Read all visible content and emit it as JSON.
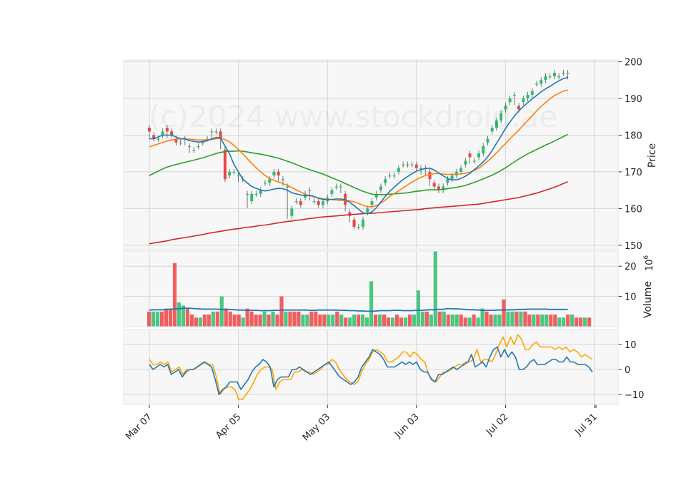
{
  "chart_data": {
    "type": "candlestick",
    "watermark": "(c)2024 www.stockdroid.ae",
    "colors": {
      "up": "#2ebd6f",
      "down": "#ef4444",
      "ma_fast": "#1f77b4",
      "ma_mid": "#ff7f0e",
      "ma_slow": "#2ca02c",
      "ma_long": "#d62728",
      "osc_1": "#1f77b4",
      "osc_2": "#ffa500",
      "volume_ma": "#1f77b4",
      "panel_bg": "#f7f7f7",
      "grid": "#d6d6d6"
    },
    "x_tick_labels": [
      "Mar 07",
      "Apr 05",
      "May 03",
      "Jun 03",
      "Jul 02",
      "Jul 31"
    ],
    "x_tick_positions": [
      0,
      20,
      40,
      60,
      80,
      100
    ],
    "price_panel": {
      "ylabel": "Price",
      "yticks": [
        150,
        160,
        170,
        180,
        190,
        200
      ],
      "ylim": [
        148.8,
        200.5
      ],
      "candles": [
        [
          182,
          181,
          180
        ],
        [
          180,
          179,
          179
        ],
        [
          179,
          179,
          180
        ],
        [
          180,
          181,
          180
        ],
        [
          182,
          181,
          180
        ],
        [
          181,
          180,
          180
        ],
        [
          179,
          178,
          178
        ],
        [
          178,
          178,
          179
        ],
        [
          179,
          179,
          178
        ],
        [
          177,
          177,
          176
        ],
        [
          176,
          176,
          177
        ],
        [
          177,
          177,
          178
        ],
        [
          178,
          178,
          179
        ],
        [
          179,
          179,
          180
        ],
        [
          181,
          181,
          180
        ],
        [
          181,
          181,
          181
        ],
        [
          181,
          179,
          177
        ],
        [
          176,
          168,
          168
        ],
        [
          169,
          170,
          170
        ],
        [
          170,
          170,
          170
        ],
        [
          169,
          169,
          168
        ],
        [
          168,
          168,
          168
        ],
        [
          164,
          164,
          161
        ],
        [
          162,
          164,
          164
        ],
        [
          164,
          164,
          164
        ],
        [
          164,
          165,
          165
        ],
        [
          167,
          167,
          167
        ],
        [
          167,
          168,
          168
        ],
        [
          169,
          170,
          170
        ],
        [
          170,
          169,
          168
        ],
        [
          168,
          168,
          167
        ],
        [
          166,
          166,
          158
        ],
        [
          158,
          160,
          160
        ],
        [
          162,
          162,
          162
        ],
        [
          162,
          161,
          161
        ],
        [
          163,
          164,
          164
        ],
        [
          165,
          165,
          163
        ],
        [
          162,
          162,
          162
        ],
        [
          162,
          161,
          161
        ],
        [
          161,
          162,
          162
        ],
        [
          162,
          163,
          163
        ],
        [
          164,
          165,
          165
        ],
        [
          166,
          166,
          166
        ],
        [
          166,
          166,
          165
        ],
        [
          164,
          161,
          160
        ],
        [
          159,
          158,
          157
        ],
        [
          157,
          155,
          155
        ],
        [
          155,
          155,
          155
        ],
        [
          155,
          157,
          157
        ],
        [
          159,
          160,
          160
        ],
        [
          161,
          162,
          162
        ],
        [
          163,
          164,
          164
        ],
        [
          165,
          166,
          167
        ],
        [
          167,
          168,
          168
        ],
        [
          169,
          169,
          169
        ],
        [
          169,
          169,
          170
        ],
        [
          170,
          171,
          171
        ],
        [
          172,
          172,
          172
        ],
        [
          172,
          172,
          172
        ],
        [
          172,
          172,
          172
        ],
        [
          172,
          171,
          171
        ],
        [
          171,
          171,
          170
        ],
        [
          171,
          171,
          170
        ],
        [
          170,
          168,
          167
        ],
        [
          167,
          166,
          166
        ],
        [
          166,
          165,
          165
        ],
        [
          165,
          166,
          167
        ],
        [
          167,
          168,
          168
        ],
        [
          168,
          169,
          169
        ],
        [
          169,
          170,
          170
        ],
        [
          170,
          171,
          172
        ],
        [
          172,
          173,
          175
        ],
        [
          175,
          174,
          173
        ],
        [
          173,
          173,
          174
        ],
        [
          174,
          175,
          175
        ],
        [
          175,
          177,
          177
        ],
        [
          178,
          179,
          180
        ],
        [
          181,
          182,
          181
        ],
        [
          182,
          184,
          184
        ],
        [
          184,
          186,
          187
        ],
        [
          187,
          188,
          189
        ],
        [
          189,
          190,
          191
        ],
        [
          191,
          191,
          189
        ],
        [
          188,
          187,
          188
        ],
        [
          189,
          190,
          190
        ],
        [
          190,
          191,
          191
        ],
        [
          191,
          192,
          193
        ],
        [
          194,
          194,
          194
        ],
        [
          194,
          195,
          195
        ],
        [
          195,
          196,
          196
        ],
        [
          196,
          196,
          196
        ],
        [
          196,
          197,
          196
        ],
        [
          196,
          196,
          196
        ],
        [
          197,
          197,
          197
        ],
        [
          197,
          197,
          196
        ]
      ],
      "ma_fast": [
        179,
        179,
        179.5,
        180,
        180,
        180,
        179.5,
        179,
        179,
        178.5,
        178.3,
        178.1,
        178.2,
        178.5,
        179,
        179.4,
        179.2,
        177,
        175,
        172,
        170,
        168,
        167,
        166,
        165.5,
        165,
        164.8,
        165,
        165.3,
        165.5,
        165.4,
        165,
        164.3,
        164,
        163.7,
        163.5,
        163.6,
        163.3,
        162.8,
        162.5,
        162.4,
        162.5,
        162.6,
        162.6,
        162.4,
        161.7,
        160.8,
        159.8,
        158.8,
        158.6,
        159.1,
        160.2,
        161.8,
        163.3,
        164.7,
        165.8,
        166.9,
        167.9,
        168.7,
        169.5,
        170.2,
        170.6,
        170.9,
        171,
        170.5,
        169.7,
        168.9,
        168.2,
        167.8,
        167.8,
        168.2,
        168.8,
        169.6,
        170.6,
        171.6,
        172.7,
        174.1,
        175.8,
        177.8,
        179.8,
        181.8,
        183.6,
        185.2,
        186.6,
        187.8,
        188.9,
        189.9,
        190.8,
        191.8,
        192.6,
        193.3,
        194.1,
        194.8,
        195.4,
        195.8
      ],
      "ma_mid": [
        176.8,
        177.2,
        177.6,
        178,
        178.4,
        178.7,
        178.9,
        179,
        179,
        178.9,
        178.8,
        178.7,
        178.7,
        178.7,
        178.8,
        179,
        179.1,
        178.8,
        178.2,
        177.2,
        176.1,
        174.9,
        173.6,
        172.3,
        171.1,
        170,
        169,
        168.2,
        167.7,
        167.2,
        166.8,
        166.3,
        165.7,
        165.1,
        164.5,
        163.9,
        163.5,
        163.2,
        162.9,
        162.7,
        162.5,
        162.4,
        162.3,
        162.2,
        162.2,
        162.1,
        161.8,
        161.4,
        160.9,
        160.5,
        160.5,
        160.8,
        161.5,
        162.3,
        163.3,
        164.1,
        164.8,
        165.6,
        166.4,
        167.2,
        167.9,
        168.5,
        169,
        169.3,
        169.5,
        169.5,
        169.4,
        169.3,
        169.3,
        169.3,
        169.4,
        169.6,
        169.9,
        170.4,
        171,
        171.9,
        172.9,
        174,
        175.2,
        176.5,
        177.7,
        179,
        180.2,
        181.4,
        182.7,
        184,
        185.3,
        186.6,
        187.8,
        188.9,
        189.9,
        190.8,
        191.4,
        192,
        192.3
      ],
      "ma_slow": [
        169,
        169.6,
        170.2,
        170.8,
        171.3,
        171.7,
        172,
        172.3,
        172.6,
        172.9,
        173.2,
        173.5,
        173.8,
        174.2,
        174.6,
        175,
        175.3,
        175.5,
        175.6,
        175.6,
        175.7,
        175.6,
        175.4,
        175.2,
        175,
        174.8,
        174.6,
        174.3,
        174,
        173.7,
        173.3,
        172.9,
        172.5,
        172,
        171.5,
        171,
        170.6,
        170.2,
        169.8,
        169.4,
        168.9,
        168.4,
        167.9,
        167.4,
        166.8,
        166.3,
        165.7,
        165.2,
        164.7,
        164.3,
        163.9,
        163.8,
        163.8,
        163.8,
        163.9,
        164,
        164.1,
        164.2,
        164.3,
        164.5,
        164.7,
        164.8,
        165,
        165.1,
        165.1,
        165.1,
        165.2,
        165.4,
        165.6,
        165.8,
        166,
        166.3,
        166.7,
        167.1,
        167.6,
        168.1,
        168.6,
        169.1,
        169.7,
        170.4,
        171.1,
        171.9,
        172.7,
        173.5,
        174.2,
        174.9,
        175.5,
        176.1,
        176.7,
        177.3,
        177.8,
        178.4,
        179,
        179.6,
        180.2
      ],
      "ma_long": [
        150.4,
        150.6,
        150.8,
        151,
        151.2,
        151.5,
        151.7,
        151.9,
        152.1,
        152.3,
        152.5,
        152.7,
        152.9,
        153.2,
        153.4,
        153.6,
        153.8,
        154,
        154.2,
        154.4,
        154.5,
        154.7,
        154.9,
        155,
        155.2,
        155.4,
        155.5,
        155.7,
        155.9,
        156.1,
        156.3,
        156.5,
        156.6,
        156.8,
        156.9,
        157.1,
        157.3,
        157.4,
        157.6,
        157.7,
        157.8,
        157.9,
        158,
        158.1,
        158.2,
        158.3,
        158.4,
        158.5,
        158.6,
        158.7,
        158.7,
        158.8,
        158.9,
        159,
        159.1,
        159.2,
        159.3,
        159.4,
        159.5,
        159.6,
        159.7,
        159.8,
        160,
        160.1,
        160.2,
        160.3,
        160.4,
        160.5,
        160.6,
        160.7,
        160.8,
        160.9,
        161,
        161.1,
        161.2,
        161.4,
        161.6,
        161.8,
        162,
        162.2,
        162.4,
        162.6,
        162.8,
        163,
        163.3,
        163.6,
        163.9,
        164.2,
        164.6,
        165,
        165.4,
        165.8,
        166.3,
        166.8,
        167.3
      ]
    },
    "volume_panel": {
      "ylabel": "Volume",
      "scale_label": "10^6",
      "yticks": [
        10,
        20
      ],
      "ylim": [
        0,
        25
      ],
      "values": [
        5,
        5,
        5,
        5,
        6,
        6,
        21,
        8,
        7,
        6,
        4,
        3,
        3,
        4,
        4,
        5,
        5,
        10,
        6,
        5,
        4,
        4,
        3,
        6,
        5,
        4,
        4,
        5,
        4,
        5,
        4,
        10,
        5,
        5,
        5,
        5,
        4,
        4,
        5,
        5,
        4,
        4,
        4,
        4,
        5,
        4,
        3,
        3,
        4,
        4,
        4,
        3,
        15,
        4,
        4,
        4,
        3,
        3,
        4,
        3,
        3,
        4,
        4,
        12,
        5,
        5,
        4,
        25,
        5,
        5,
        4,
        4,
        4,
        4,
        3,
        3,
        4,
        3,
        6,
        5,
        4,
        4,
        4,
        9,
        5,
        5,
        5,
        5,
        5,
        4,
        4,
        4,
        4,
        4,
        4,
        4,
        3,
        3,
        4,
        4,
        3,
        3,
        3,
        3
      ],
      "ma": [
        5.5,
        5.6,
        5.6,
        5.6,
        5.7,
        5.8,
        5.9,
        6,
        6.1,
        6.1,
        6,
        5.9,
        5.8,
        5.8,
        5.8,
        5.8,
        5.7,
        5.7,
        5.7,
        5.6,
        5.5,
        5.5,
        5.4,
        5.4,
        5.4,
        5.3,
        5.3,
        5.3,
        5.4,
        5.4,
        5.5,
        5.5,
        5.5,
        5.5,
        5.5,
        5.5,
        5.4,
        5.4,
        5.5,
        5.5,
        5.5,
        5.5,
        5.5,
        5.4,
        5.4,
        5.3,
        5.3,
        5.2,
        5.2,
        5.1,
        5.1,
        5.2,
        5.3,
        5.3,
        5.3,
        5.4,
        5.4,
        5.3,
        5.3,
        5.3,
        5.4,
        5.4,
        5.5,
        5.6,
        5.6,
        5.7,
        5.7,
        6,
        5.9,
        5.9,
        5.8,
        5.7,
        5.6,
        5.6,
        5.5,
        5.4,
        5.4,
        5.4,
        5.5,
        5.5,
        5.5,
        5.6,
        5.6,
        5.7,
        5.7,
        5.8,
        5.8,
        5.8,
        5.8,
        5.8,
        5.7,
        5.7,
        5.7,
        5.7,
        5.7
      ]
    },
    "oscillator_panel": {
      "yticks": [
        -10,
        0,
        10
      ],
      "ylim": [
        -14,
        16
      ],
      "line_1": [
        2,
        0,
        1,
        2,
        1,
        2,
        -2,
        -1,
        0,
        -3,
        -1,
        0,
        0,
        1,
        2,
        3,
        2,
        1,
        -4,
        -10,
        -8,
        -7,
        -5,
        -5,
        -5,
        -8,
        -6,
        -4,
        -1,
        1,
        2,
        4,
        3,
        1,
        -7,
        -4,
        -3,
        -3,
        -3,
        0,
        0,
        1,
        0,
        -1,
        -2,
        -1,
        0,
        1,
        2,
        3,
        1,
        -1,
        -3,
        -4,
        -5,
        -6,
        -5,
        -3,
        1,
        3,
        5,
        8,
        7,
        6,
        4,
        1,
        1,
        1,
        2,
        3,
        2,
        3,
        2,
        3,
        0,
        -1,
        -1,
        -4,
        -5,
        -2,
        -2,
        -1,
        0,
        1,
        0,
        1,
        2,
        3,
        6,
        1,
        2,
        3,
        1,
        5,
        8,
        9,
        5,
        8,
        5,
        7,
        5,
        0,
        0,
        1,
        3,
        4,
        2,
        2,
        2,
        3,
        4,
        4,
        3,
        3,
        5,
        3,
        3,
        2,
        2,
        2,
        1,
        -1
      ],
      "line_2": [
        4,
        2,
        2,
        3,
        2,
        3,
        -1,
        0,
        1,
        -2,
        0,
        0,
        0,
        1,
        2,
        3,
        2,
        2,
        -3,
        -10,
        -8,
        -7,
        -7,
        -8,
        -12,
        -12,
        -10,
        -8,
        -5,
        -2,
        0,
        1,
        1,
        0,
        -8,
        -5,
        -4,
        -4,
        -4,
        -1,
        -1,
        0,
        -1,
        -1,
        -2,
        -1,
        0,
        2,
        2,
        4,
        3,
        0,
        -2,
        -4,
        -5,
        -6,
        -5,
        -1,
        2,
        4,
        7,
        8,
        7,
        6,
        3,
        3,
        4,
        5,
        7,
        7,
        5,
        7,
        6,
        4,
        3,
        -2,
        -4,
        -5,
        -3,
        -1,
        -1,
        0,
        1,
        2,
        2,
        3,
        3,
        4,
        8,
        3,
        4,
        4,
        3,
        6,
        10,
        13,
        9,
        13,
        10,
        14,
        12,
        8,
        8,
        10,
        11,
        9,
        9,
        9,
        9,
        8,
        9,
        8,
        9,
        7,
        8,
        7,
        5,
        6,
        5,
        4
      ],
      "line_note": ""
    }
  }
}
